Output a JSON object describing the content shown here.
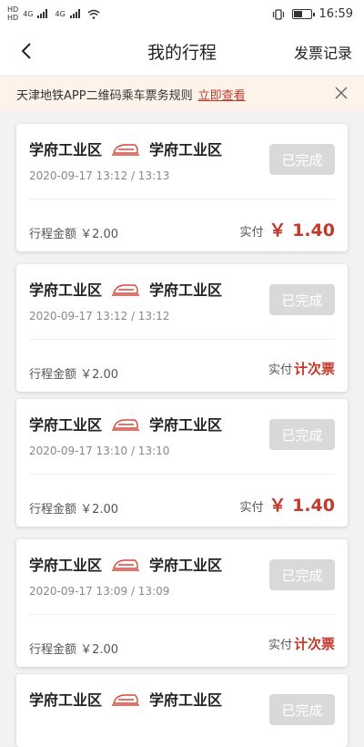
{
  "status_bar": {
    "left_tag_1": "HD",
    "left_tag_2": "HD",
    "net_1": "4G",
    "net_2": "4G",
    "time": "16:59"
  },
  "header": {
    "title": "我的行程",
    "invoice_label": "发票记录"
  },
  "notice": {
    "text": "天津地铁APP二维码乘车票务规则",
    "link": "立即查看"
  },
  "trips": [
    {
      "from": "学府工业区",
      "to": "学府工业区",
      "datetime": "2020-09-17 13:12 / 13:13",
      "status": "已完成",
      "fare_label": "行程金额 ￥2.00",
      "paid_label": "实付",
      "paid_value": "￥ 1.40"
    },
    {
      "from": "学府工业区",
      "to": "学府工业区",
      "datetime": "2020-09-17 13:12 / 13:12",
      "status": "已完成",
      "fare_label": "行程金额 ￥2.00",
      "paid_label": "实付",
      "paid_value": "计次票"
    },
    {
      "from": "学府工业区",
      "to": "学府工业区",
      "datetime": "2020-09-17 13:10 / 13:10",
      "status": "已完成",
      "fare_label": "行程金额 ￥2.00",
      "paid_label": "实付",
      "paid_value": "￥ 1.40"
    },
    {
      "from": "学府工业区",
      "to": "学府工业区",
      "datetime": "2020-09-17 13:09 / 13:09",
      "status": "已完成",
      "fare_label": "行程金额 ￥2.00",
      "paid_label": "实付",
      "paid_value": "计次票"
    },
    {
      "from": "学府工业区",
      "to": "学府工业区",
      "status": "已完成"
    }
  ],
  "colors": {
    "accent": "#c0392b",
    "status_button": "#d9d9d9",
    "notice_bg": "#fdf3ea"
  }
}
